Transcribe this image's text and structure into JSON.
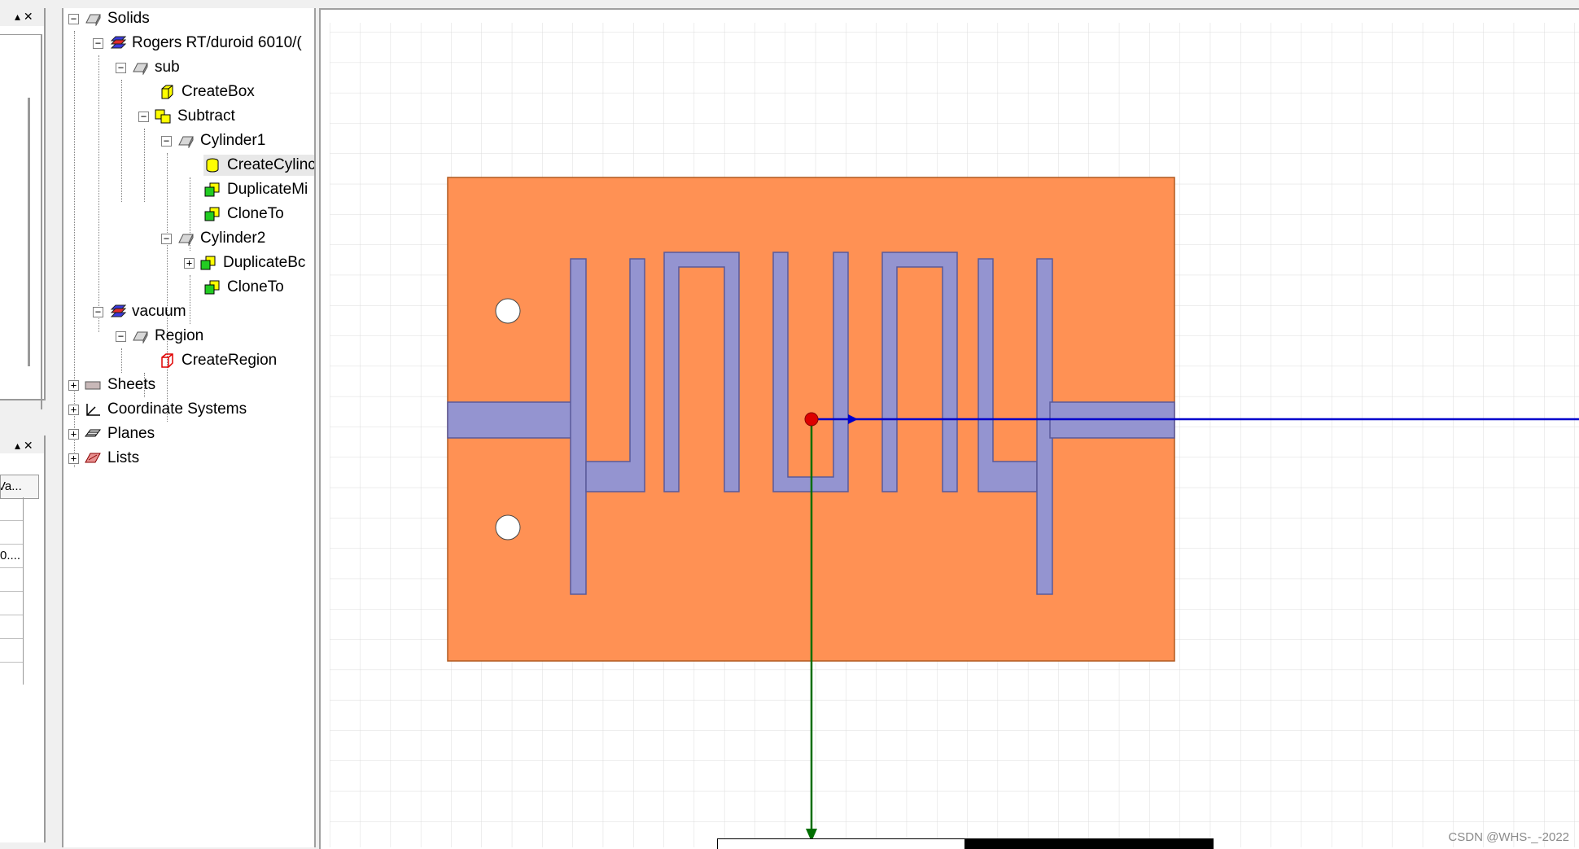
{
  "left_panes": {
    "pane1_controls": "▴ ✕",
    "pane2_controls": "▴ ✕",
    "grid_header": "Va...",
    "grid_cell": "0...."
  },
  "tree": {
    "items": [
      {
        "label": "Solids"
      },
      {
        "label": "Rogers RT/duroid 6010/("
      },
      {
        "label": "sub"
      },
      {
        "label": "CreateBox"
      },
      {
        "label": "Subtract"
      },
      {
        "label": "Cylinder1"
      },
      {
        "label": "CreateCylinc"
      },
      {
        "label": "DuplicateMi"
      },
      {
        "label": "CloneTo"
      },
      {
        "label": "Cylinder2"
      },
      {
        "label": "DuplicateBc"
      },
      {
        "label": "CloneTo"
      },
      {
        "label": "vacuum"
      },
      {
        "label": "Region"
      },
      {
        "label": "CreateRegion"
      },
      {
        "label": "Sheets"
      },
      {
        "label": "Coordinate Systems"
      },
      {
        "label": "Planes"
      },
      {
        "label": "Lists"
      }
    ]
  },
  "viewport": {
    "watermark": "CSDN @WHS-_-2022",
    "colors": {
      "substrate": "#ff9154",
      "conductor": "#9494d0",
      "grid": "#d9d9d9",
      "x_axis": "#0000cc",
      "y_axis": "#006e00",
      "origin": "#dd0000"
    }
  }
}
